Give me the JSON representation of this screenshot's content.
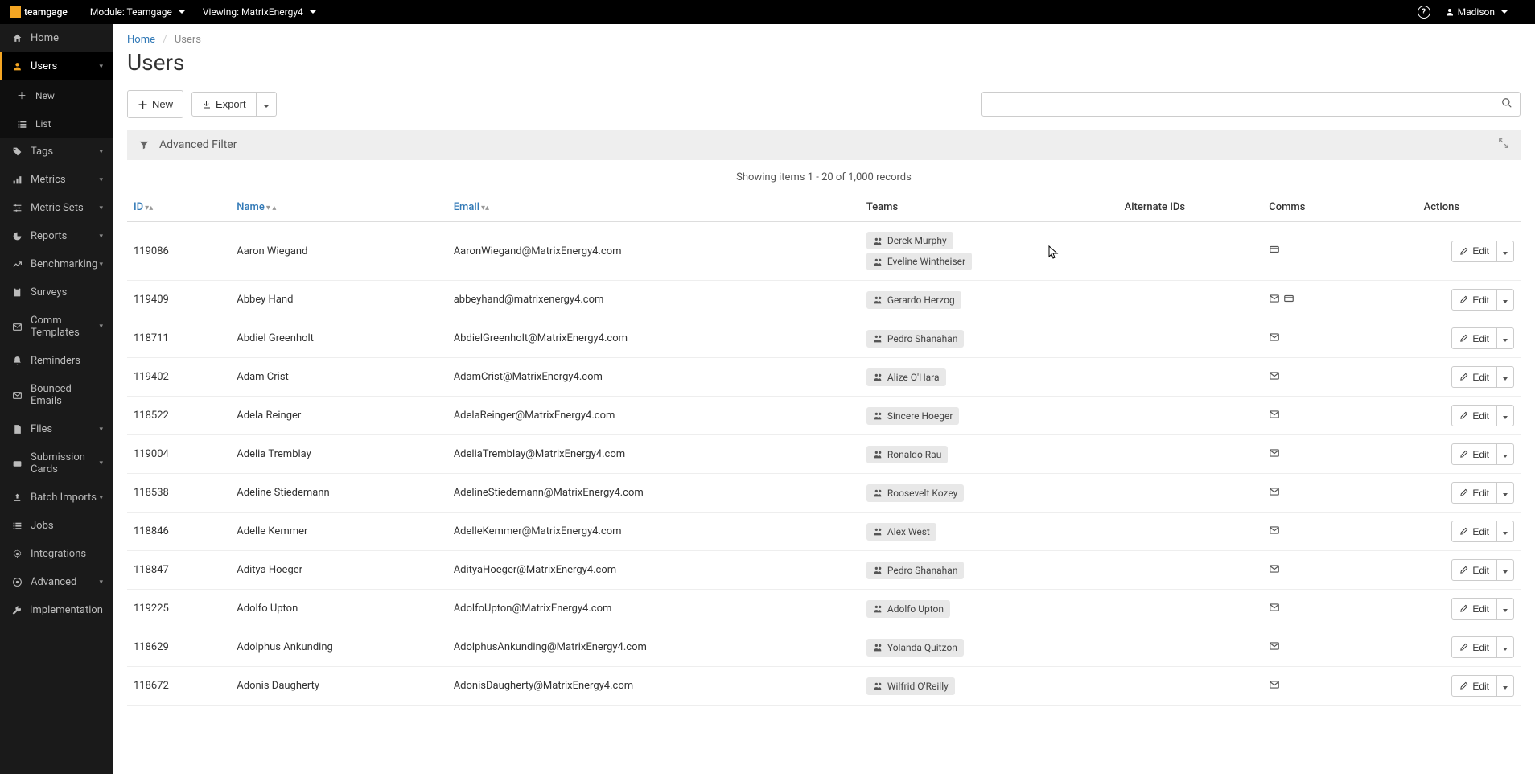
{
  "topbar": {
    "brand": "teamgage",
    "module_label": "Module: Teamgage",
    "viewing_label": "Viewing: MatrixEnergy4",
    "user_name": "Madison"
  },
  "sidebar": {
    "home": "Home",
    "users": "Users",
    "new": "New",
    "list": "List",
    "tags": "Tags",
    "metrics": "Metrics",
    "metric_sets": "Metric Sets",
    "reports": "Reports",
    "benchmarking": "Benchmarking",
    "surveys": "Surveys",
    "comm_templates": "Comm Templates",
    "reminders": "Reminders",
    "bounced_emails": "Bounced Emails",
    "files": "Files",
    "submission_cards": "Submission Cards",
    "batch_imports": "Batch Imports",
    "jobs": "Jobs",
    "integrations": "Integrations",
    "advanced": "Advanced",
    "implementation": "Implementation"
  },
  "breadcrumb": {
    "home": "Home",
    "current": "Users"
  },
  "page_title": "Users",
  "toolbar": {
    "new": "New",
    "export": "Export"
  },
  "filter_label": "Advanced Filter",
  "showing_text": "Showing items 1 - 20 of 1,000 records",
  "columns": {
    "id": "ID",
    "name": "Name",
    "email": "Email",
    "teams": "Teams",
    "alt": "Alternate IDs",
    "comms": "Comms",
    "actions": "Actions"
  },
  "edit_label": "Edit",
  "rows": [
    {
      "id": "119086",
      "name": "Aaron Wiegand",
      "email": "AaronWiegand@MatrixEnergy4.com",
      "teams": [
        "Derek Murphy",
        "Eveline Wintheiser"
      ],
      "comms": [
        "card"
      ]
    },
    {
      "id": "119409",
      "name": "Abbey Hand",
      "email": "abbeyhand@matrixenergy4.com",
      "teams": [
        "Gerardo Herzog"
      ],
      "comms": [
        "mail",
        "card"
      ]
    },
    {
      "id": "118711",
      "name": "Abdiel Greenholt",
      "email": "AbdielGreenholt@MatrixEnergy4.com",
      "teams": [
        "Pedro Shanahan"
      ],
      "comms": [
        "mail"
      ]
    },
    {
      "id": "119402",
      "name": "Adam Crist",
      "email": "AdamCrist@MatrixEnergy4.com",
      "teams": [
        "Alize O'Hara"
      ],
      "comms": [
        "mail"
      ]
    },
    {
      "id": "118522",
      "name": "Adela Reinger",
      "email": "AdelaReinger@MatrixEnergy4.com",
      "teams": [
        "Sincere Hoeger"
      ],
      "comms": [
        "mail"
      ]
    },
    {
      "id": "119004",
      "name": "Adelia Tremblay",
      "email": "AdeliaTremblay@MatrixEnergy4.com",
      "teams": [
        "Ronaldo Rau"
      ],
      "comms": [
        "mail"
      ]
    },
    {
      "id": "118538",
      "name": "Adeline Stiedemann",
      "email": "AdelineStiedemann@MatrixEnergy4.com",
      "teams": [
        "Roosevelt Kozey"
      ],
      "comms": [
        "mail"
      ]
    },
    {
      "id": "118846",
      "name": "Adelle Kemmer",
      "email": "AdelleKemmer@MatrixEnergy4.com",
      "teams": [
        "Alex West"
      ],
      "comms": [
        "mail"
      ]
    },
    {
      "id": "118847",
      "name": "Aditya Hoeger",
      "email": "AdityaHoeger@MatrixEnergy4.com",
      "teams": [
        "Pedro Shanahan"
      ],
      "comms": [
        "mail"
      ]
    },
    {
      "id": "119225",
      "name": "Adolfo Upton",
      "email": "AdolfoUpton@MatrixEnergy4.com",
      "teams": [
        "Adolfo Upton"
      ],
      "comms": [
        "mail"
      ]
    },
    {
      "id": "118629",
      "name": "Adolphus Ankunding",
      "email": "AdolphusAnkunding@MatrixEnergy4.com",
      "teams": [
        "Yolanda Quitzon"
      ],
      "comms": [
        "mail"
      ]
    },
    {
      "id": "118672",
      "name": "Adonis Daugherty",
      "email": "AdonisDaugherty@MatrixEnergy4.com",
      "teams": [
        "Wilfrid O'Reilly"
      ],
      "comms": [
        "mail"
      ]
    }
  ]
}
